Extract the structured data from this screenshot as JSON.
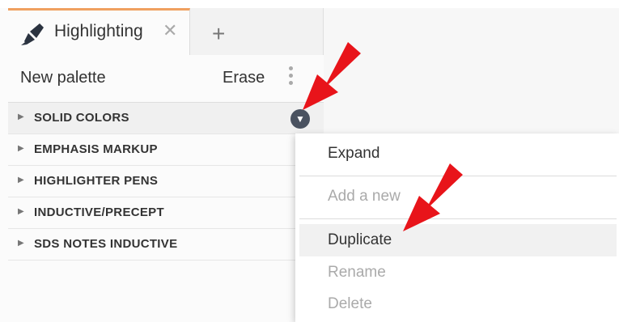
{
  "tab": {
    "label": "Highlighting",
    "close_glyph": "✕",
    "icon": "highlighter-pen-icon"
  },
  "add_tab_glyph": "+",
  "toolbar": {
    "new_palette_label": "New palette",
    "erase_label": "Erase"
  },
  "palettes": [
    {
      "label": "SOLID COLORS"
    },
    {
      "label": "EMPHASIS MARKUP"
    },
    {
      "label": "HIGHLIGHTER PENS"
    },
    {
      "label": "INDUCTIVE/PRECEPT"
    },
    {
      "label": "SDS NOTES INDUCTIVE"
    }
  ],
  "menu": {
    "expand": "Expand",
    "add_new": "Add a new",
    "duplicate": "Duplicate",
    "rename": "Rename",
    "delete": "Delete"
  },
  "colors": {
    "accent_tab": "#f0a060",
    "annotation_arrow": "#e8141a",
    "dropdown_button": "#4a5260"
  }
}
